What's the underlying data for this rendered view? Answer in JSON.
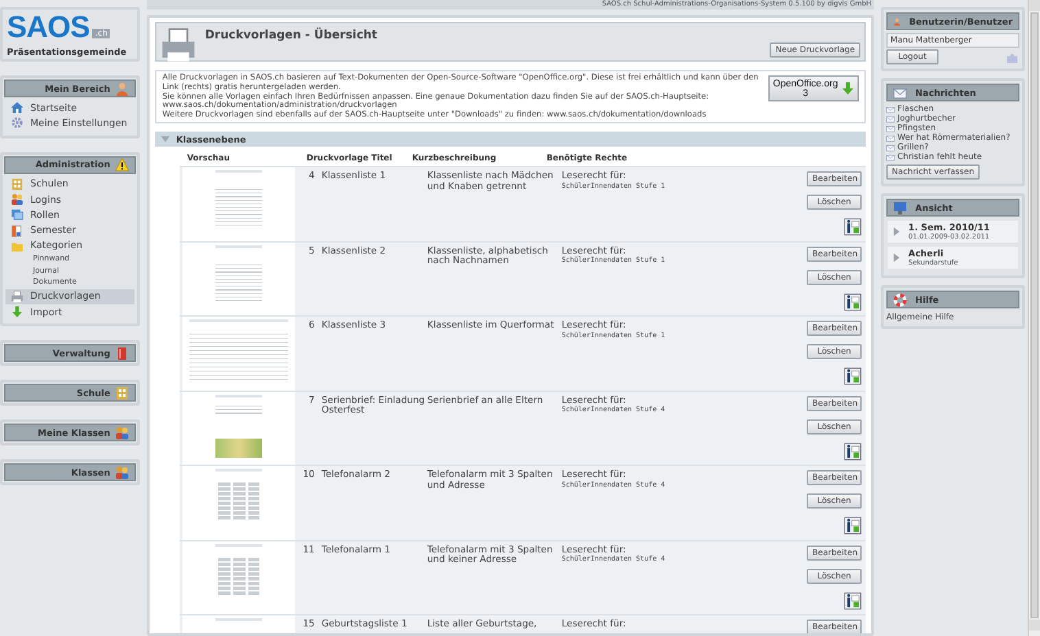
{
  "app_bar": {
    "title": "SAOS.ch Schul-Administrations-Organisations-System 0.5.100 by digvis GmbH"
  },
  "logo": {
    "text": "SAOS",
    "suffix": ".ch",
    "organisation": "Präsentationsgemeinde"
  },
  "nav_sections": [
    {
      "title": "Mein Bereich",
      "items": [
        {
          "label": "Startseite",
          "selected": false
        },
        {
          "label": "Meine Einstellungen",
          "selected": false
        }
      ]
    },
    {
      "title": "Administration",
      "items": [
        {
          "label": "Schulen",
          "selected": false
        },
        {
          "label": "Logins",
          "selected": false
        },
        {
          "label": "Rollen",
          "selected": false
        },
        {
          "label": "Semester",
          "selected": false
        },
        {
          "label": "Kategorien",
          "selected": false,
          "children": [
            {
              "label": "Pinnwand",
              "selected": false
            },
            {
              "label": "Journal",
              "selected": false
            },
            {
              "label": "Dokumente",
              "selected": false
            }
          ]
        },
        {
          "label": "Druckvorlagen",
          "selected": true
        },
        {
          "label": "Import",
          "selected": false
        }
      ]
    },
    {
      "title": "Verwaltung"
    },
    {
      "title": "Schule"
    },
    {
      "title": "Meine Klassen"
    },
    {
      "title": "Klassen"
    }
  ],
  "page": {
    "title": "Druckvorlagen - Übersicht",
    "new_button": "Neue Druckvorlage"
  },
  "intro": {
    "paragraphs": [
      "Alle Druckvorlagen in SAOS.ch basieren auf Text-Dokumenten der Open-Source-Software \"OpenOffice.org\". Diese ist frei erhältlich und kann über den Link (rechts) gratis heruntergeladen werden.",
      "Sie können alle Vorlagen einfach Ihren Bedürfnissen anpassen. Eine genaue Dokumentation dazu finden Sie auf der SAOS.ch-Hauptseite: www.saos.ch/dokumentation/administration/druckvorlagen",
      "Weitere Druckvorlagen sind ebenfalls auf der SAOS.ch-Hauptseite unter \"Downloads\" zu finden: www.saos.ch/dokumentation/downloads"
    ],
    "download_button": "OpenOffice.org 3"
  },
  "section": {
    "title": "Klassenebene",
    "columns": [
      "Vorschau",
      "Druckvorlage Titel",
      "Kurzbeschreibung",
      "Benötigte Rechte"
    ],
    "rows": [
      {
        "kind": "list",
        "number": "4",
        "title": "Klassenliste 1",
        "description": "Klassenliste nach Mädchen und Knaben getrennt",
        "rights_label": "Leserecht für:",
        "rights": "SchülerInnendaten Stufe 1",
        "edit_button": "Bearbeiten",
        "delete_button": "Löschen"
      },
      {
        "kind": "list",
        "number": "5",
        "title": "Klassenliste 2",
        "description": "Klassenliste, alphabetisch nach Nachnamen",
        "rights_label": "Leserecht für:",
        "rights": "SchülerInnendaten Stufe 1",
        "edit_button": "Bearbeiten",
        "delete_button": "Löschen"
      },
      {
        "kind": "landscape",
        "number": "6",
        "title": "Klassenliste 3",
        "description": "Klassenliste im Querformat",
        "rights_label": "Leserecht für:",
        "rights": "SchülerInnendaten Stufe 1",
        "edit_button": "Bearbeiten",
        "delete_button": "Löschen"
      },
      {
        "kind": "letter",
        "number": "7",
        "title": "Serienbrief: Einladung Osterfest",
        "description": "Serienbrief an alle Eltern",
        "rights_label": "Leserecht für:",
        "rights": "SchülerInnendaten Stufe 4",
        "edit_button": "Bearbeiten",
        "delete_button": "Löschen"
      },
      {
        "kind": "grid",
        "number": "10",
        "title": "Telefonalarm 2",
        "description": "Telefonalarm mit 3 Spalten und Adresse",
        "rights_label": "Leserecht für:",
        "rights": "SchülerInnendaten Stufe 4",
        "edit_button": "Bearbeiten",
        "delete_button": "Löschen"
      },
      {
        "kind": "grid",
        "number": "11",
        "title": "Telefonalarm 1",
        "description": "Telefonalarm mit 3 Spalten und keiner Adresse",
        "rights_label": "Leserecht für:",
        "rights": "SchülerInnendaten Stufe 4",
        "edit_button": "Bearbeiten",
        "delete_button": "Löschen"
      },
      {
        "kind": "list",
        "number": "15",
        "title": "Geburtstagsliste 1",
        "description": "Liste aller Geburtstage,",
        "rights_label": "Leserecht für:",
        "edit_button": "Bearbeiten"
      }
    ]
  },
  "user_panel": {
    "title": "Benutzerin/Benutzer",
    "name": "Manu Mattenberger",
    "logout_button": "Logout"
  },
  "messages_panel": {
    "title": "Nachrichten",
    "messages": [
      "Flaschen",
      "Joghurtbecher",
      "Pfingsten",
      "Wer hat Römermaterialien?",
      "Grillen?",
      "Christian fehlt heute"
    ],
    "compose_button": "Nachricht verfassen"
  },
  "view_panel": {
    "title": "Ansicht",
    "entries": [
      {
        "title": "1. Sem. 2010/11",
        "subtitle": "01.01.2009-03.02.2011"
      },
      {
        "title": "Acherli",
        "subtitle": "Sekundarstufe"
      }
    ]
  },
  "help_panel": {
    "title": "Hilfe",
    "links": [
      "Allgemeine Hilfe"
    ]
  }
}
